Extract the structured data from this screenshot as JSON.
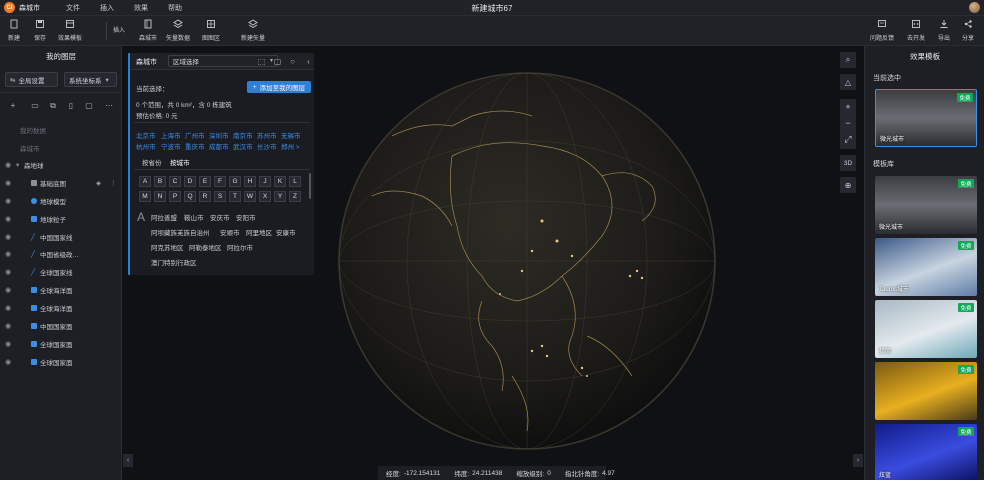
{
  "app": {
    "logo_text": "CI",
    "name": "森城市",
    "doc_title": "新建城市67"
  },
  "menu": [
    "文件",
    "插入",
    "效果",
    "帮助"
  ],
  "toolbar": {
    "new_label": "新建",
    "save_label": "保存",
    "effect_label": "效果模板",
    "insert_label": "插入",
    "city_label": "森城市",
    "vector_label": "矢量数据",
    "layer_label": "图图区",
    "new_asset_label": "新建矢量",
    "feedback_label": "问题反馈",
    "dev_label": "去开发",
    "export_label": "导出",
    "share_label": "分享"
  },
  "left_panel": {
    "title": "我的图层",
    "global_settings": "全局设置",
    "coord_system": "系统坐标系",
    "tree": [
      {
        "label": "我的数据",
        "dim": true
      },
      {
        "label": "森城市",
        "dim": true
      },
      {
        "label": "森地球",
        "dim": false
      },
      {
        "label": "基础底图",
        "dim": false
      },
      {
        "label": "地球模型",
        "dim": false
      },
      {
        "label": "地球粒子",
        "dim": false
      },
      {
        "label": "中国国家线",
        "dim": false
      },
      {
        "label": "中国省级政…",
        "dim": false
      },
      {
        "label": "全球国家线",
        "dim": false
      },
      {
        "label": "全球海洋面",
        "dim": false
      },
      {
        "label": "全球海洋面",
        "dim": false
      },
      {
        "label": "中国国家面",
        "dim": false
      },
      {
        "label": "全球国家面",
        "dim": false
      },
      {
        "label": "全球国家面",
        "dim": false
      }
    ]
  },
  "region_panel": {
    "brand": "森城市",
    "select_value": "区域选择",
    "current_label": "当前选择：",
    "add_button": "添加至我的图层",
    "summary": "0 个范围，共 0 km²，含 0 栋建筑",
    "price": "预估价格: 0 元",
    "cities_row1": [
      "北京市",
      "上海市",
      "广州市",
      "深圳市",
      "南京市",
      "苏州市",
      "无锡市"
    ],
    "cities_row2": [
      "杭州市",
      "宁波市",
      "重庆市",
      "成都市",
      "武汉市",
      "长沙市",
      "郑州 >"
    ],
    "tabs": [
      "按省份",
      "按城市"
    ],
    "letters": [
      "A",
      "B",
      "C",
      "D",
      "E",
      "F",
      "G",
      "H",
      "J",
      "K",
      "L",
      "M",
      "N",
      "P",
      "Q",
      "R",
      "S",
      "T",
      "W",
      "X",
      "Y",
      "Z"
    ],
    "big_letter": "A",
    "regions": [
      "阿拉善盟",
      "鞍山市",
      "安庆市",
      "安阳市",
      "阿坝藏族羌族自治州",
      "安顺市",
      "阿里地区",
      "安康市",
      "阿克苏地区",
      "阿勒泰地区",
      "阿拉尔市",
      "澳门特别行政区"
    ]
  },
  "map_controls": {
    "zoom_in": "+",
    "zoom_out": "−",
    "view3d": "3D"
  },
  "status": {
    "lon_label": "经度:",
    "lon": "-172.154131",
    "lat_label": "纬度:",
    "lat": "24.211438",
    "zoom_label": "缩放级别:",
    "zoom": "0",
    "heading_label": "指北针角度:",
    "heading": "4.97"
  },
  "right_panel": {
    "title": "效果模板",
    "current_section": "当前选中",
    "library_section": "模板库",
    "current_card": {
      "name": "微光城市",
      "badge": "免费"
    },
    "cards": [
      {
        "name": "微光城市",
        "badge": "免费"
      },
      {
        "name": "Taurus城市",
        "badge": "免费"
      },
      {
        "name": "极简",
        "badge": "免费"
      },
      {
        "name": "",
        "badge": "免费"
      },
      {
        "name": "炫蓝",
        "badge": "免费"
      }
    ]
  },
  "colors": {
    "accent": "#2d7fd8",
    "badge_green": "#12a85a",
    "logo_orange": "#f47a1f"
  }
}
